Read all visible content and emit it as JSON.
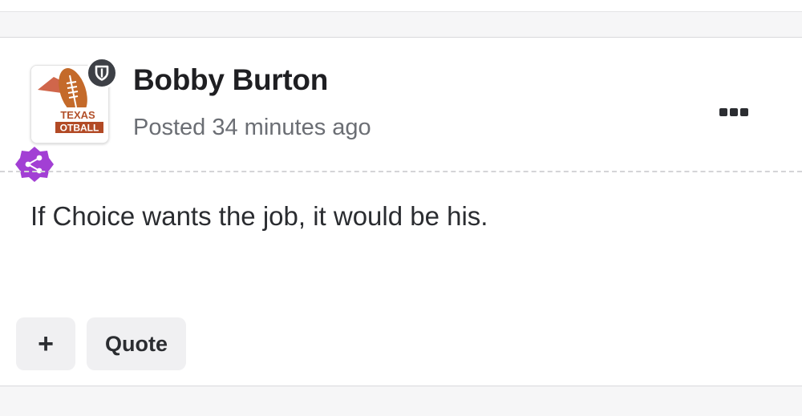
{
  "post": {
    "author": "Bobby Burton",
    "posted": "Posted 34 minutes ago",
    "body": "If Choice wants the job, it would be his.",
    "avatar": {
      "text_line1": "TEXAS",
      "text_line2": "OTBALL",
      "icon": "football-logo"
    },
    "badges": {
      "moderator_icon": "shield-icon",
      "share_icon": "share-icon",
      "share_color": "#a23fd4"
    },
    "more_icon": "ellipsis-icon"
  },
  "actions": {
    "plus_label": "+",
    "quote_label": "Quote"
  }
}
